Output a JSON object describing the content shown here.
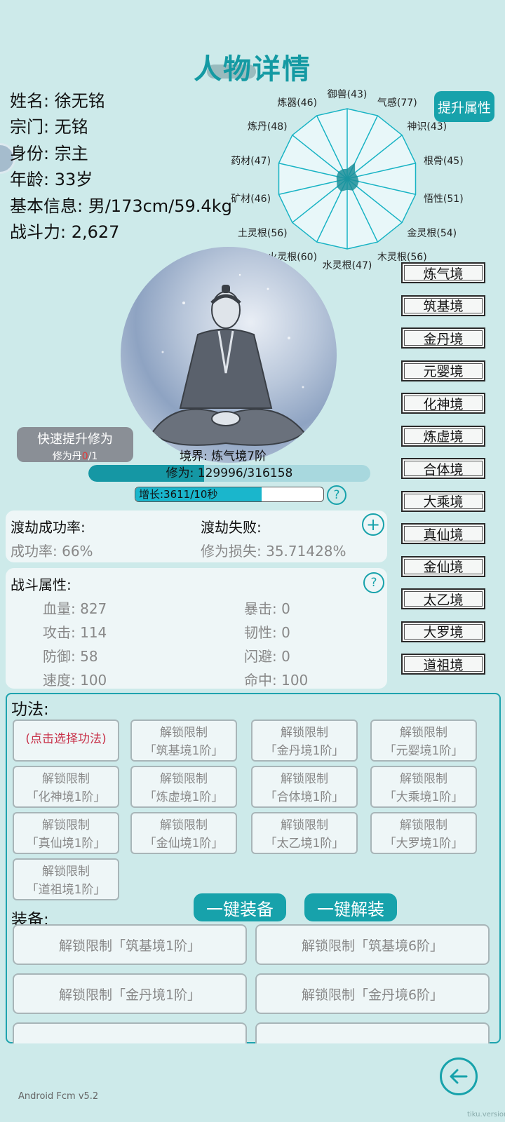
{
  "page": {
    "title": "人物详情"
  },
  "info": {
    "name": "姓名: 徐无铭",
    "sect": "宗门: 无铭",
    "identity": "身份: 宗主",
    "age": "年龄: 33岁",
    "basic": "基本信息: 男/173cm/59.4kg",
    "power": "战斗力: 2,627"
  },
  "upgrade_button": "提升属性",
  "radar": {
    "labels": [
      "御兽(43)",
      "气感(77)",
      "神识(43)",
      "根骨(45)",
      "悟性(51)",
      "金灵根(54)",
      "木灵根(56)",
      "水灵根(47)",
      "火灵根(60)",
      "土灵根(56)",
      "矿材(46)",
      "药材(47)",
      "炼丹(48)",
      "炼器(46)"
    ],
    "values": [
      43,
      77,
      43,
      45,
      51,
      54,
      56,
      47,
      60,
      56,
      46,
      47,
      48,
      46
    ],
    "colors": {
      "grid": "#18b3c4",
      "fill": "#1b8f9a"
    }
  },
  "realms": [
    "炼气境",
    "筑基境",
    "金丹境",
    "元婴境",
    "化神境",
    "炼虚境",
    "合体境",
    "大乘境",
    "真仙境",
    "金仙境",
    "太乙境",
    "大罗境",
    "道祖境"
  ],
  "quick": {
    "label": "快速提升修为",
    "pill_prefix": "修为丹",
    "pill_count": "0",
    "pill_suffix": "/1"
  },
  "realm_line": "境界: 炼气境7阶",
  "cultivation": {
    "text": "修为: 129996/316158",
    "fraction": 0.411
  },
  "growth": {
    "text": "增长:3611/10秒",
    "fraction": 0.67
  },
  "tribulation": {
    "success_title": "渡劫成功率:",
    "success_value": "成功率:  66%",
    "fail_title": "渡劫失败:",
    "fail_value": "修为损失:  35.71428%"
  },
  "combat": {
    "title": "战斗属性:",
    "left": [
      "血量: 827",
      "攻击: 114",
      "防御: 58",
      "速度: 100"
    ],
    "right": [
      "暴击: 0",
      "韧性: 0",
      "闪避: 0",
      "命中: 100"
    ]
  },
  "skills": {
    "title": "功法:",
    "select": "(点击选择功法)",
    "lock": "解锁限制",
    "items": [
      "「筑基境1阶」",
      "「金丹境1阶」",
      "「元婴境1阶」",
      "「化神境1阶」",
      "「炼虚境1阶」",
      "「合体境1阶」",
      "「大乘境1阶」",
      "「真仙境1阶」",
      "「金仙境1阶」",
      "「太乙境1阶」",
      "「大罗境1阶」",
      "「道祖境1阶」"
    ]
  },
  "equip": {
    "title": "装备:",
    "one_click_equip": "一键装备",
    "one_click_unequip": "一键解装",
    "items": [
      "解锁限制「筑基境1阶」",
      "解锁限制「筑基境6阶」",
      "解锁限制「金丹境1阶」",
      "解锁限制「金丹境6阶」"
    ]
  },
  "help_symbol": "?",
  "plus_symbol": "+",
  "version": "Android Fcm v5.2",
  "watermark": "tiku.version"
}
